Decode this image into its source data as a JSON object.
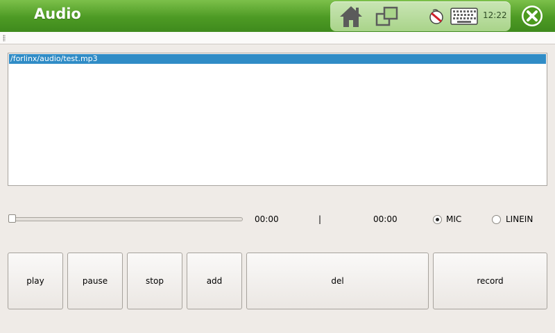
{
  "window": {
    "title": "Audio"
  },
  "tray": {
    "clock": "12:22"
  },
  "playlist": {
    "items": [
      "/forlinx/audio/test.mp3"
    ]
  },
  "player": {
    "position": 0,
    "elapsed": "00:00",
    "separator": "|",
    "total": "00:00"
  },
  "source": {
    "options": [
      "MIC",
      "LINEIN"
    ],
    "selected": "MIC"
  },
  "buttons": {
    "play": "play",
    "pause": "pause",
    "stop": "stop",
    "add": "add",
    "del": "del",
    "record": "record"
  },
  "colors": {
    "titlebar": "#4d9a24",
    "selection": "#308cc6",
    "close": "#4c9a1e"
  },
  "icons": [
    "home-icon",
    "windows-icon",
    "input-method-icon",
    "keyboard-icon",
    "close-icon"
  ]
}
